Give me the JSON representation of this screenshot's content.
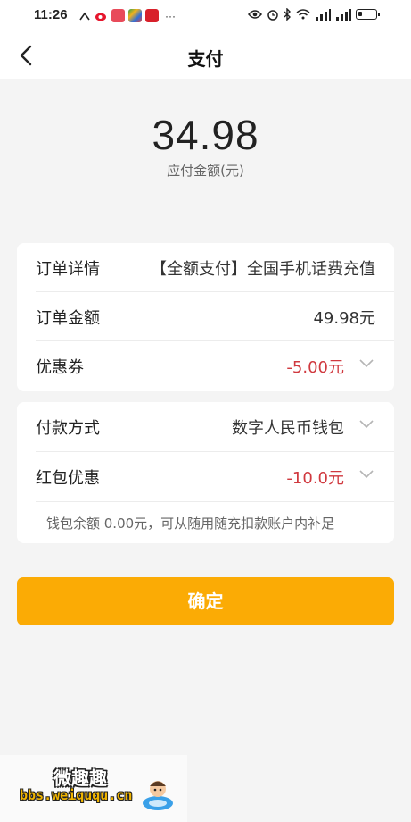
{
  "status_bar": {
    "time": "11:26",
    "battery_level": 0.25,
    "icons": [
      "weather-icon",
      "weibo-icon",
      "app-icon",
      "app-icon",
      "app-icon",
      "more-icon",
      "eye-icon",
      "alarm-icon",
      "bluetooth-icon",
      "wifi-icon",
      "signal-icon",
      "signal-icon",
      "battery-icon"
    ]
  },
  "nav": {
    "title": "支付"
  },
  "payment": {
    "amount": "34.98",
    "amount_label": "应付金额(元)"
  },
  "order_card": {
    "rows": [
      {
        "label": "订单详情",
        "value": "【全额支付】全国手机话费充值"
      },
      {
        "label": "订单金额",
        "value": "49.98元"
      },
      {
        "label": "优惠券",
        "value": "-5.00元"
      }
    ]
  },
  "method_card": {
    "rows": [
      {
        "label": "付款方式",
        "value": "数字人民币钱包"
      },
      {
        "label": "红包优惠",
        "value": "-10.0元"
      }
    ],
    "balance_note": "钱包余额  0.00元，可从随用随充扣款账户内补足"
  },
  "confirm_label": "确定",
  "watermark": {
    "title": "微趣趣",
    "url": "bbs.weiququ.cn"
  },
  "colors": {
    "accent": "#fbab05",
    "discount": "#d0393f"
  }
}
